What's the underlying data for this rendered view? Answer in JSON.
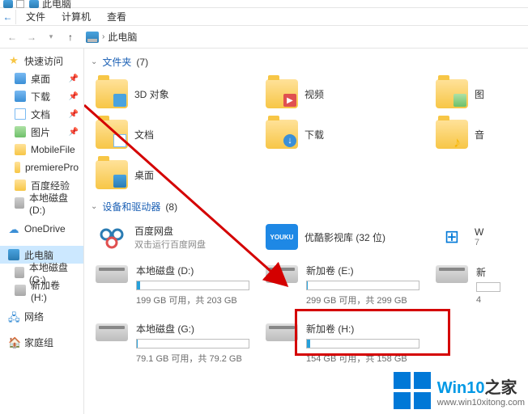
{
  "window": {
    "title": "此电脑"
  },
  "menubar": {
    "items": [
      "文件",
      "计算机",
      "查看"
    ]
  },
  "breadcrumb": {
    "root": "此电脑"
  },
  "sidebar": {
    "quick_access": "快速访问",
    "items_pinned": [
      {
        "label": "桌面"
      },
      {
        "label": "下载"
      },
      {
        "label": "文档"
      },
      {
        "label": "图片"
      }
    ],
    "items_folders": [
      {
        "label": "MobileFile"
      },
      {
        "label": "premierePro"
      },
      {
        "label": "百度经验"
      },
      {
        "label": "本地磁盘 (D:)"
      }
    ],
    "onedrive": "OneDrive",
    "this_pc": "此电脑",
    "drives": [
      {
        "label": "本地磁盘 (G:)"
      },
      {
        "label": "新加卷 (H:)"
      }
    ],
    "network": "网络",
    "homegroup": "家庭组"
  },
  "main": {
    "section_folders": {
      "title": "文件夹",
      "count": "(7)"
    },
    "folders": [
      {
        "label": "3D 对象"
      },
      {
        "label": "视频"
      },
      {
        "label": "图"
      },
      {
        "label": "文档"
      },
      {
        "label": "下载"
      },
      {
        "label": "音"
      },
      {
        "label": "桌面"
      }
    ],
    "section_drives": {
      "title": "设备和驱动器",
      "count": "(8)"
    },
    "apps": [
      {
        "label": "百度网盘",
        "sub": "双击运行百度网盘"
      },
      {
        "label": "优酷影视库 (32 位)",
        "sub": ""
      },
      {
        "label": "W",
        "sub": "7"
      }
    ],
    "drives": [
      {
        "label": "本地磁盘 (D:)",
        "free": "199 GB 可用，共 203 GB",
        "pct": 2
      },
      {
        "label": "新加卷 (E:)",
        "free": "299 GB 可用，共 299 GB",
        "pct": 0
      },
      {
        "label": "新",
        "free": "4",
        "pct": 0
      },
      {
        "label": "本地磁盘 (G:)",
        "free": "79.1 GB 可用，共 79.2 GB",
        "pct": 0
      },
      {
        "label": "新加卷 (H:)",
        "free": "154 GB 可用，共 158 GB",
        "pct": 3
      }
    ]
  },
  "watermark": {
    "title_a": "Win10",
    "title_b": "之家",
    "url": "www.win10xitong.com"
  }
}
